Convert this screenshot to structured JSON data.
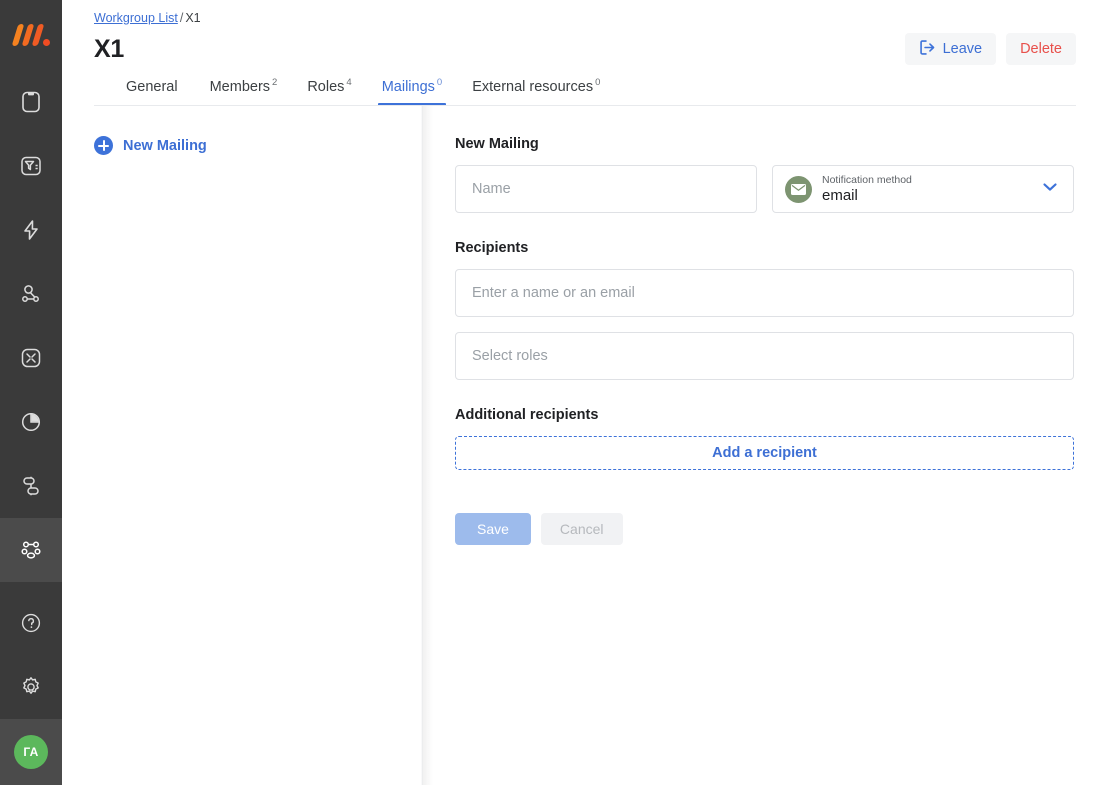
{
  "sidebar": {
    "logo_name": "app-logo",
    "items": [
      {
        "name": "tablet-icon",
        "label": "Devices",
        "active": false
      },
      {
        "name": "filter-list-icon",
        "label": "Filters",
        "active": false
      },
      {
        "name": "lightning-bolt-icon",
        "label": "Automations",
        "active": false
      },
      {
        "name": "node-link-icon",
        "label": "Connections",
        "active": false
      },
      {
        "name": "qr-scan-icon",
        "label": "Scan",
        "active": false
      },
      {
        "name": "pie-chart-icon",
        "label": "Reports",
        "active": false
      },
      {
        "name": "flow-branch-icon",
        "label": "Flows",
        "active": false
      },
      {
        "name": "workgroups-icon",
        "label": "Workgroups",
        "active": true
      }
    ],
    "bottom_items": [
      {
        "name": "help-circle-icon",
        "label": "Help"
      },
      {
        "name": "gear-icon",
        "label": "Settings"
      }
    ],
    "avatar_initials": "ГА"
  },
  "breadcrumb": {
    "root_label": "Workgroup List",
    "separator": "/",
    "current": "X1"
  },
  "header": {
    "title": "X1",
    "leave_label": "Leave",
    "delete_label": "Delete"
  },
  "tabs": [
    {
      "label": "General",
      "badge": "",
      "active": false
    },
    {
      "label": "Members",
      "badge": "2",
      "active": false
    },
    {
      "label": "Roles",
      "badge": "4",
      "active": false
    },
    {
      "label": "Mailings",
      "badge": "0",
      "active": true
    },
    {
      "label": "External resources",
      "badge": "0",
      "active": false
    }
  ],
  "list_panel": {
    "new_mailing_label": "New Mailing"
  },
  "form": {
    "heading": "New Mailing",
    "name_placeholder": "Name",
    "notification": {
      "caption": "Notification method",
      "value": "email"
    },
    "recipients_label": "Recipients",
    "recipients_placeholder": "Enter a name or an email",
    "roles_placeholder": "Select roles",
    "additional_label": "Additional recipients",
    "add_recipient_label": "Add a recipient",
    "save_label": "Save",
    "cancel_label": "Cancel"
  },
  "colors": {
    "accent_blue": "#3d72d9",
    "link_blue": "#3d6fd4",
    "danger_red": "#e8504b",
    "rail_bg": "#3a3a3a",
    "rail_active": "#4b4b4b",
    "avatar_green": "#5cb85c",
    "mail_icon_green": "#7d9471",
    "save_disabled_blue": "#9dbbec"
  }
}
